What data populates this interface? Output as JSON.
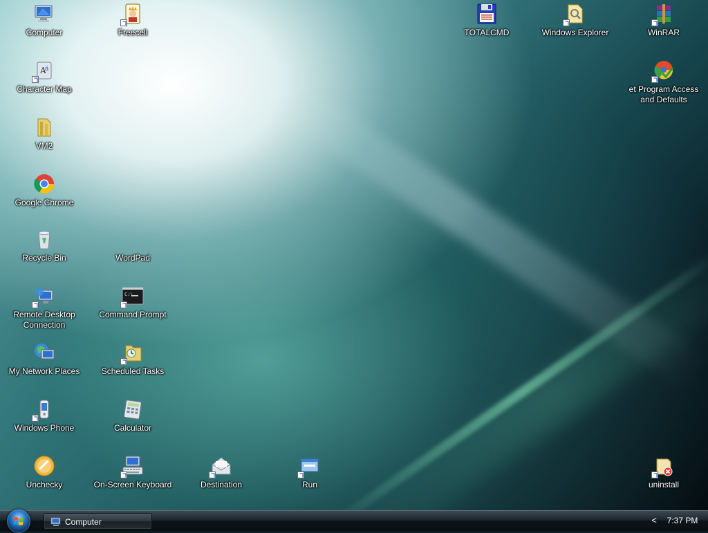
{
  "desktop": {
    "icons": {
      "computer": "Computer",
      "freecell": "Freecell",
      "totalcmd": "TOTALCMD",
      "windows_explorer": "Windows Explorer",
      "winrar": "WinRAR",
      "character_map": "Character Map",
      "set_program_access": "et Program Access and Defaults",
      "vm2": "VM2",
      "google_chrome": "Google Chrome",
      "recycle_bin": "Recycle Bin",
      "wordpad": "WordPad",
      "remote_desktop": "Remote Desktop Connection",
      "command_prompt": "Command Prompt",
      "my_network_places": "My Network Places",
      "scheduled_tasks": "Scheduled Tasks",
      "windows_phone": "Windows Phone",
      "calculator": "Calculator",
      "unchecky": "Unchecky",
      "onscreen_keyboard": "On-Screen Keyboard",
      "destination": "Destination",
      "run": "Run",
      "uninstall": "uninstall"
    }
  },
  "taskbar": {
    "active_window": "Computer",
    "tray_chevron": "<",
    "clock": "7:37 PM"
  },
  "colors": {
    "taskbar_dark": "#0d1317",
    "label_text": "#ffffff"
  }
}
